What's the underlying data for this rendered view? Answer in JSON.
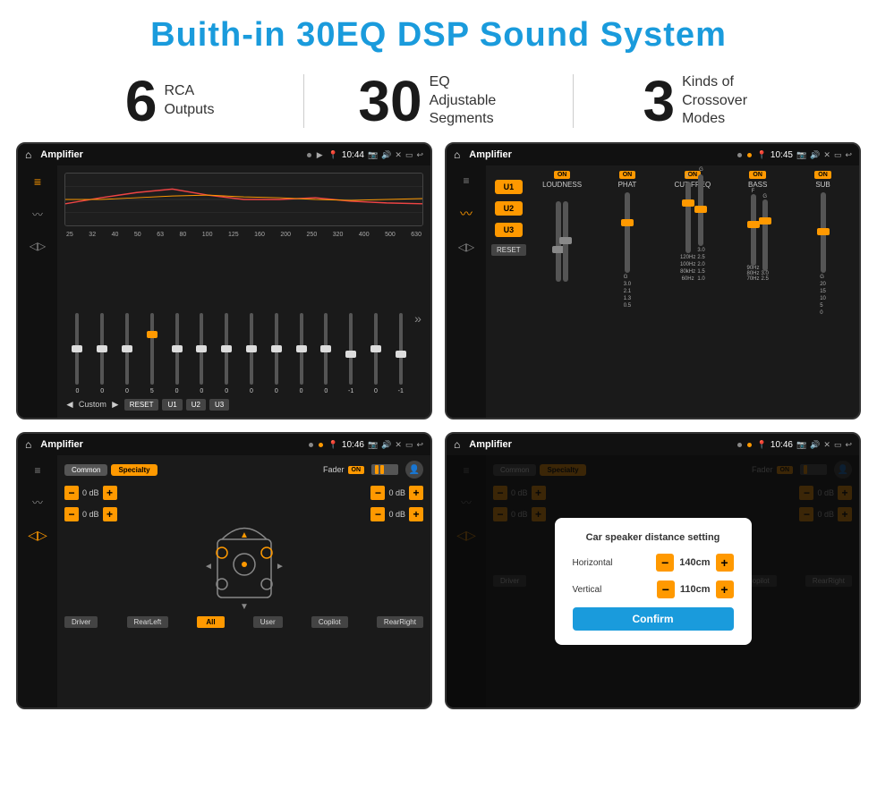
{
  "header": {
    "title": "Buith-in 30EQ DSP Sound System"
  },
  "stats": [
    {
      "number": "6",
      "label": "RCA\nOutputs"
    },
    {
      "number": "30",
      "label": "EQ Adjustable\nSegments"
    },
    {
      "number": "3",
      "label": "Kinds of\nCrossover Modes"
    }
  ],
  "screens": [
    {
      "id": "screen-eq",
      "time": "10:44",
      "app": "Amplifier",
      "freqs": [
        "25",
        "32",
        "40",
        "50",
        "63",
        "80",
        "100",
        "125",
        "160",
        "200",
        "250",
        "320",
        "400",
        "500",
        "630"
      ],
      "values": [
        "0",
        "0",
        "0",
        "5",
        "0",
        "0",
        "0",
        "0",
        "0",
        "0",
        "0",
        "-1",
        "0",
        "-1"
      ],
      "preset": "Custom",
      "buttons": [
        "RESET",
        "U1",
        "U2",
        "U3"
      ]
    },
    {
      "id": "screen-crossover",
      "time": "10:45",
      "app": "Amplifier",
      "presets": [
        "U1",
        "U2",
        "U3"
      ],
      "channels": [
        "LOUDNESS",
        "PHAT",
        "CUT FREQ",
        "BASS",
        "SUB"
      ]
    },
    {
      "id": "screen-speaker",
      "time": "10:46",
      "app": "Amplifier",
      "tabs": [
        "Common",
        "Specialty"
      ],
      "fader": "Fader",
      "faderState": "ON",
      "dbValues": [
        "0 dB",
        "0 dB",
        "0 dB",
        "0 dB"
      ],
      "buttons": [
        "Driver",
        "RearLeft",
        "All",
        "User",
        "Copilot",
        "RearRight"
      ]
    },
    {
      "id": "screen-dialog",
      "time": "10:46",
      "app": "Amplifier",
      "dialog": {
        "title": "Car speaker distance setting",
        "fields": [
          {
            "label": "Horizontal",
            "value": "140cm"
          },
          {
            "label": "Vertical",
            "value": "110cm"
          }
        ],
        "confirm": "Confirm"
      }
    }
  ]
}
